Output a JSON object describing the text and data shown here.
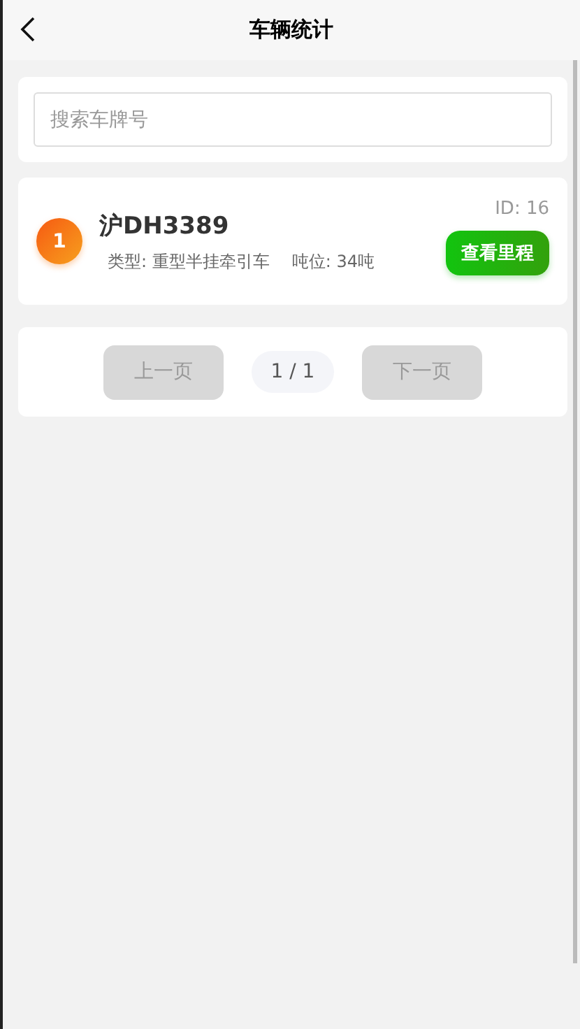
{
  "header": {
    "title": "车辆统计"
  },
  "search": {
    "placeholder": "搜索车牌号"
  },
  "vehicles": [
    {
      "index": "1",
      "plate": "沪DH3389",
      "id": "ID: 16",
      "type": "类型: 重型半挂牵引车",
      "tonnage": "吨位: 34吨",
      "action": "查看里程"
    }
  ],
  "pagination": {
    "prev": {
      "label": "上一页",
      "disabled": true
    },
    "page": "1 / 1",
    "next": {
      "label": "下一页",
      "disabled": true
    }
  }
}
